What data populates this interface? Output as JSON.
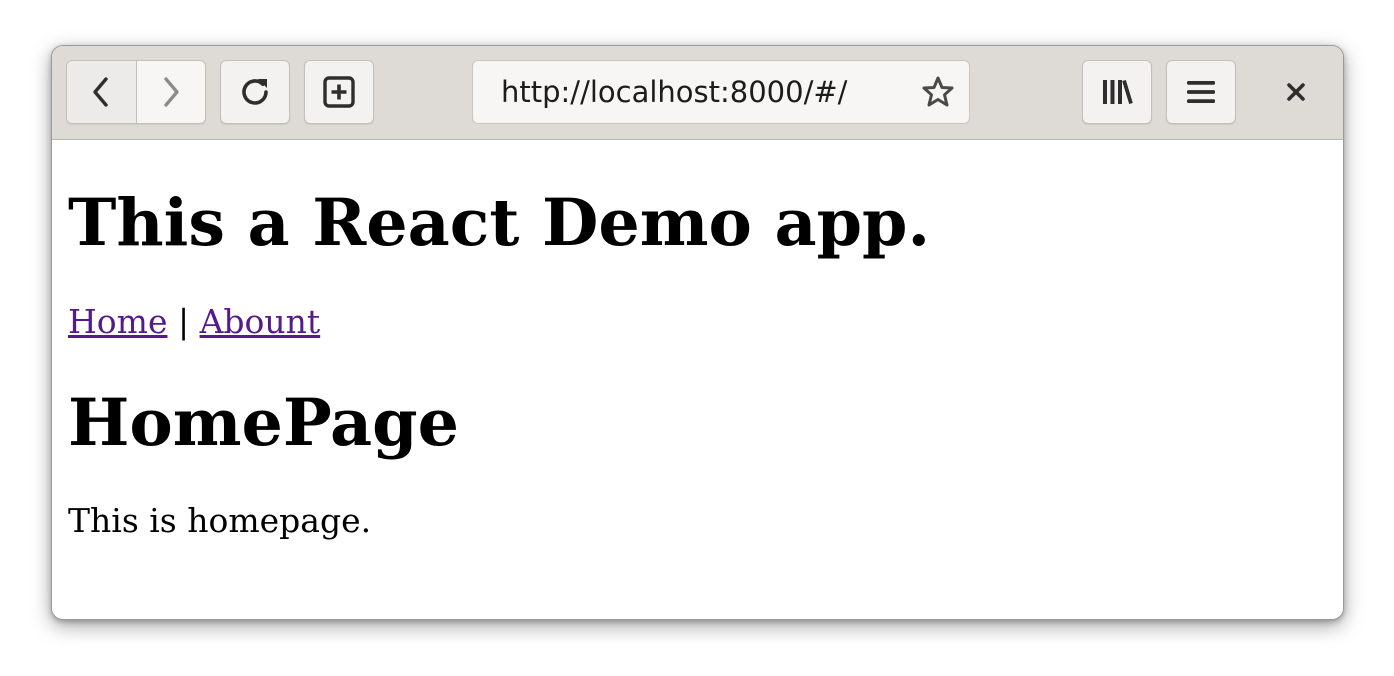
{
  "browser": {
    "url": "http://localhost:8000/#/",
    "icons": {
      "back": "chevron-left-icon",
      "forward": "chevron-right-icon",
      "reload": "reload-icon",
      "new_tab": "plus-square-icon",
      "bookmark": "star-icon",
      "library": "library-icon",
      "menu": "hamburger-menu-icon",
      "close": "close-icon"
    },
    "colors": {
      "toolbar_bg": "#dedbd7",
      "button_bg": "#f3f2f1"
    }
  },
  "page": {
    "title": "This a React Demo app.",
    "nav": {
      "home": "Home",
      "separator": "|",
      "about": "Abount"
    },
    "heading": "HomePage",
    "text": "This is homepage.",
    "colors": {
      "link": "#551a8b",
      "text": "#000000"
    }
  }
}
